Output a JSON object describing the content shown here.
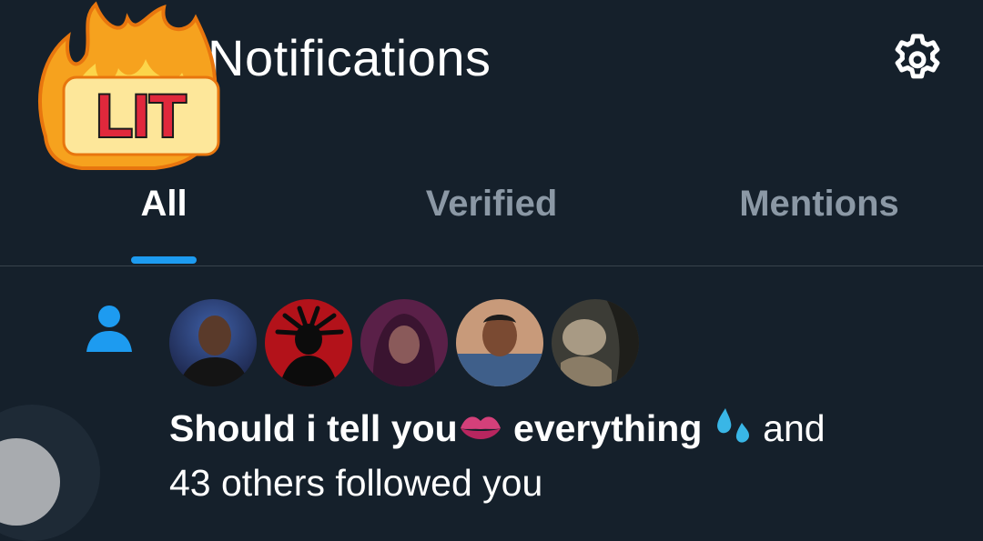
{
  "header": {
    "title": "Notifications",
    "sticker_text": "LIT"
  },
  "tabs": [
    {
      "label": "All",
      "active": true
    },
    {
      "label": "Verified",
      "active": false
    },
    {
      "label": "Mentions",
      "active": false
    }
  ],
  "notification": {
    "type_icon": "person-icon",
    "avatars": [
      "avatar-1",
      "avatar-2",
      "avatar-3",
      "avatar-4",
      "avatar-5"
    ],
    "name_part1": "Should i tell you",
    "name_part2": "everything",
    "and_text": "and",
    "rest_text": "43 others followed you"
  },
  "colors": {
    "background": "#15202b",
    "accent": "#1d9bf0",
    "muted": "#8b98a5",
    "divider": "#38444d"
  }
}
